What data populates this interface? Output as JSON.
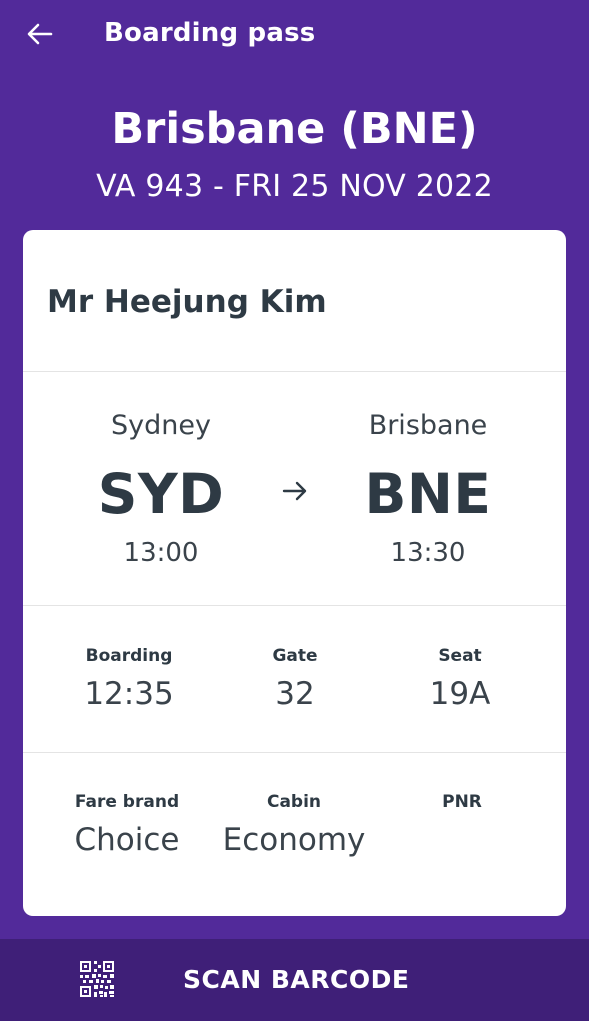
{
  "header": {
    "title": "Boarding pass",
    "back_icon": "arrow-left-icon"
  },
  "flight": {
    "destination_title": "Brisbane (BNE)",
    "subtitle": "VA 943 - FRI 25 NOV 2022"
  },
  "card": {
    "passenger_name": "Mr Heejung Kim",
    "origin": {
      "city": "Sydney",
      "code": "SYD",
      "time": "13:00"
    },
    "destination": {
      "city": "Brisbane",
      "code": "BNE",
      "time": "13:30"
    },
    "route_icon": "arrow-right-icon",
    "details_row1": {
      "boarding_label": "Boarding",
      "boarding_value": "12:35",
      "gate_label": "Gate",
      "gate_value": "32",
      "seat_label": "Seat",
      "seat_value": "19A"
    },
    "details_row2": {
      "fare_label": "Fare brand",
      "fare_value": "Choice",
      "cabin_label": "Cabin",
      "cabin_value": "Economy",
      "pnr_label": "PNR",
      "pnr_value": ""
    }
  },
  "footer": {
    "scan_label": "SCAN BARCODE",
    "scan_icon": "qr-code-icon"
  },
  "colors": {
    "background": "#522a9a",
    "footer": "#3f1f78",
    "card": "#ffffff",
    "text_dark": "#2e3a44"
  }
}
